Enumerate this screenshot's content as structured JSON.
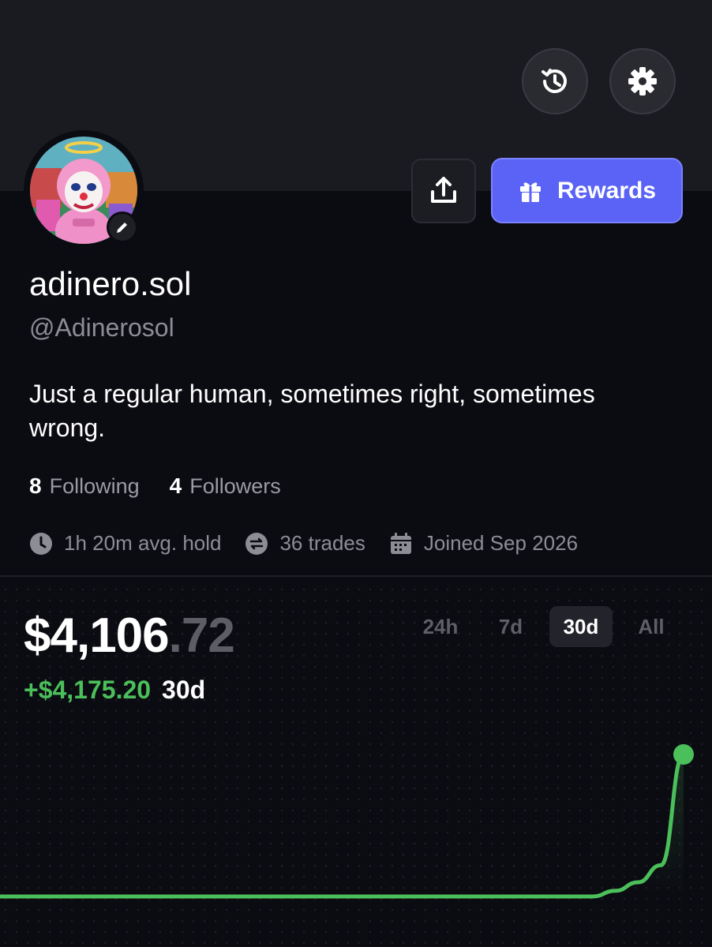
{
  "toolbar": {
    "history_icon": "history-icon",
    "settings_icon": "gear-icon"
  },
  "profile": {
    "display_name": "adinero.sol",
    "handle": "@Adinerosol",
    "bio": "Just a regular human, sometimes right, sometimes wrong.",
    "following_count": "8",
    "following_label": "Following",
    "followers_count": "4",
    "followers_label": "Followers"
  },
  "actions": {
    "share_icon": "share-icon",
    "rewards_label": "Rewards",
    "rewards_icon": "gift-icon"
  },
  "meta": {
    "avg_hold": "1h 20m avg. hold",
    "trades": "36 trades",
    "joined": "Joined Sep 2026"
  },
  "portfolio": {
    "balance_main": "$4,106",
    "balance_cents": ".72",
    "pnl_value": "+$4,175.20",
    "pnl_period": "30d",
    "ranges": [
      "24h",
      "7d",
      "30d",
      "All"
    ],
    "active_range": "30d"
  },
  "colors": {
    "accent": "#5a63f5",
    "positive": "#4bbf5a",
    "background": "#0b0b12",
    "header": "#1a1a21"
  },
  "chart_data": {
    "type": "line",
    "title": "",
    "xlabel": "",
    "ylabel": "",
    "period": "30d",
    "x": [
      0,
      5,
      10,
      15,
      20,
      25,
      26,
      27,
      28,
      29,
      30
    ],
    "series": [
      {
        "values": [
          0,
          0,
          0,
          0,
          0,
          0,
          0,
          4,
          10,
          22,
          100
        ]
      }
    ],
    "ylim": [
      0,
      100
    ],
    "grid": false,
    "legend": "none"
  }
}
